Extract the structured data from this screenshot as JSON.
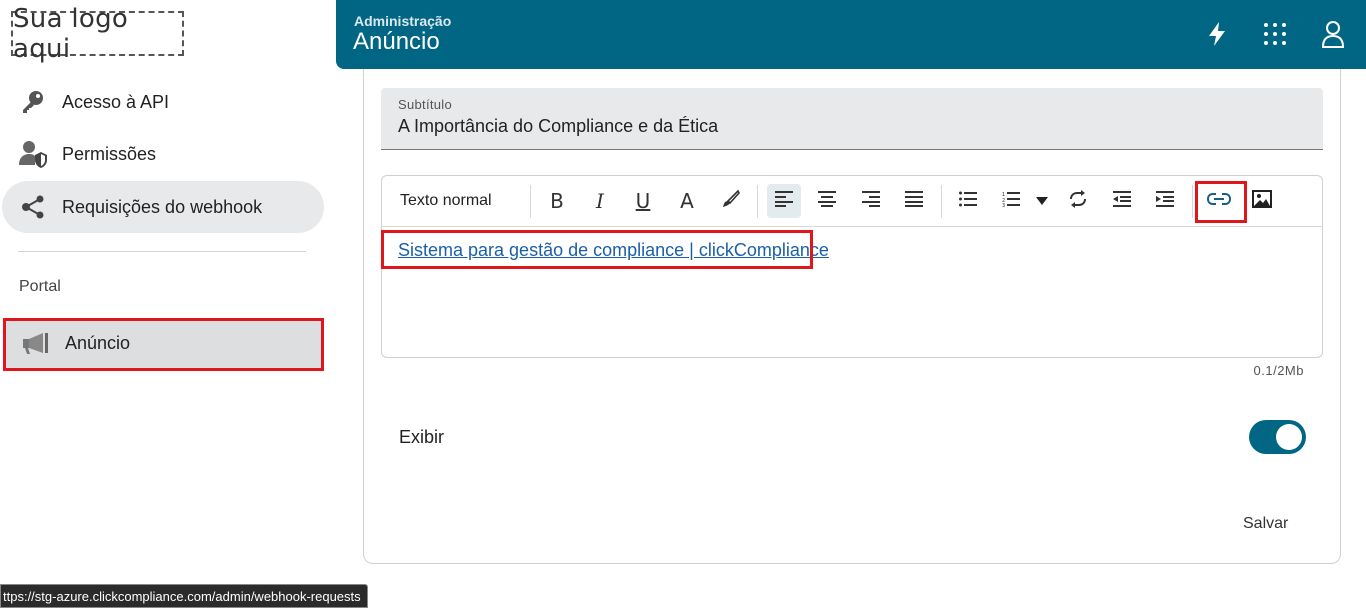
{
  "sidebar": {
    "logo_text": "Sua logo aqui",
    "items": [
      {
        "label": "Acesso à API",
        "icon": "key-icon"
      },
      {
        "label": "Permissões",
        "icon": "user-shield-icon"
      },
      {
        "label": "Requisições do webhook",
        "icon": "share-nodes-icon"
      }
    ],
    "section_label": "Portal",
    "section_items": [
      {
        "label": "Anúncio",
        "icon": "megaphone-icon"
      }
    ]
  },
  "header": {
    "breadcrumb": "Administração",
    "title": "Anúncio",
    "icons": [
      "lightning-icon",
      "apps-grid-icon",
      "user-icon"
    ],
    "color": "#006684"
  },
  "form": {
    "subtitle_label": "Subtítulo",
    "subtitle_value": "A Importância do Compliance e da Ética",
    "toolbar": {
      "text_style": "Texto normal",
      "buttons": [
        "bold",
        "italic",
        "underline",
        "font-color",
        "highlight",
        "align-left",
        "align-center",
        "align-right",
        "align-justify",
        "bullet-list",
        "numbered-list",
        "redo",
        "outdent",
        "indent",
        "link",
        "image"
      ],
      "active": "align-left"
    },
    "editor_link_text": "Sistema para gestão de compliance | clickCompliance",
    "size_info": "0.1/2Mb",
    "exibir_label": "Exibir",
    "exibir_enabled": true,
    "save_label": "Salvar"
  },
  "status_bar_url": "ttps://stg-azure.clickcompliance.com/admin/webhook-requests"
}
